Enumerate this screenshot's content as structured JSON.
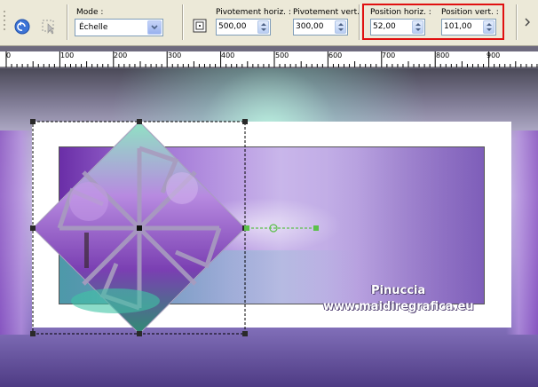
{
  "toolbar": {
    "mode_label": "Mode :",
    "mode_value": "Échelle",
    "pivot_horiz_label": "Pivotement horiz. :",
    "pivot_horiz_value": "500,00",
    "pivot_vert_label": "Pivotement vert. :",
    "pivot_vert_value": "300,00",
    "pos_horiz_label": "Position horiz. :",
    "pos_horiz_value": "52,00",
    "pos_vert_label": "Position vert. :",
    "pos_vert_value": "101,00"
  },
  "ruler": {
    "labels": [
      "0",
      "100",
      "200",
      "300",
      "400",
      "500",
      "600",
      "700",
      "800",
      "900"
    ]
  },
  "watermark": {
    "line1": "Pinuccia",
    "line2": "www.maidiregrafica.eu"
  },
  "colors": {
    "highlight": "#e01010",
    "toolbar_bg": "#ece9d8"
  }
}
